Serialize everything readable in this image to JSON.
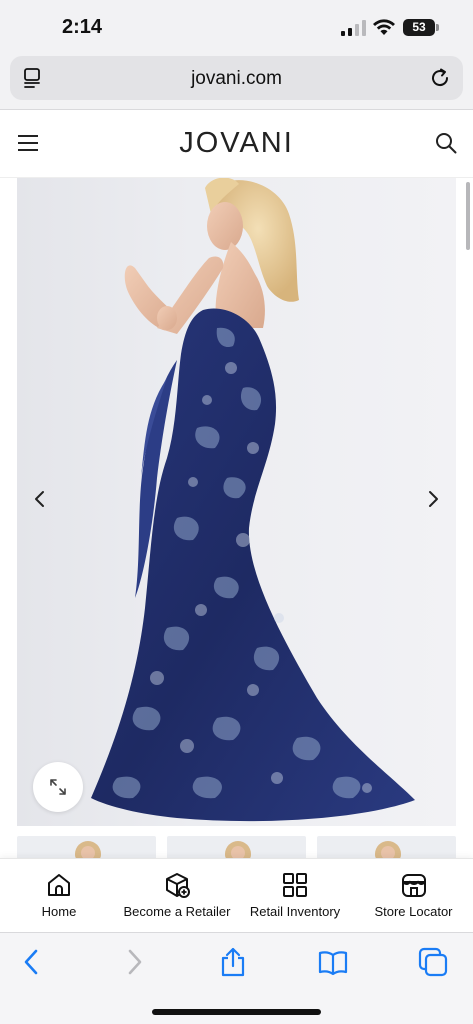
{
  "status_bar": {
    "time": "2:14",
    "battery": "53"
  },
  "browser": {
    "url": "jovani.com",
    "icons": [
      "reader-mode-icon",
      "reload-icon"
    ]
  },
  "site_header": {
    "logo": "JOVANI",
    "icons": [
      "hamburger-menu-icon",
      "search-icon"
    ]
  },
  "gallery": {
    "image": "product-photo-navy-strapless-jacquard-mermaid-gown",
    "icons": [
      "chevron-left-icon",
      "chevron-right-icon",
      "expand-icon"
    ],
    "thumbnail_count": 3
  },
  "bottom_nav": {
    "items": [
      {
        "label": "Home",
        "icon": "home-icon"
      },
      {
        "label": "Become a Retailer",
        "icon": "box-plus-icon"
      },
      {
        "label": "Retail Inventory",
        "icon": "grid-icon"
      },
      {
        "label": "Store Locator",
        "icon": "storefront-icon"
      }
    ]
  },
  "toolbar": {
    "icons": [
      "back-icon",
      "forward-icon",
      "share-icon",
      "bookmarks-icon",
      "tabs-icon"
    ]
  },
  "colors": {
    "safari_blue": "#1a7cf5",
    "dress_navy": "#1e2a63",
    "bar_gray": "#f2f2f4"
  }
}
